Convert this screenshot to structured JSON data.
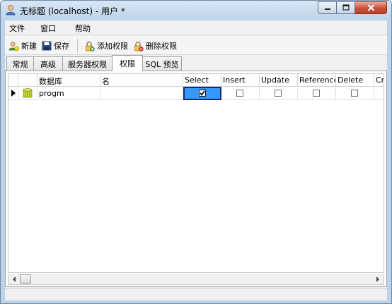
{
  "window": {
    "title": "无标题 (localhost) - 用户 *",
    "icon": "user-icon"
  },
  "menu": {
    "items": [
      "文件",
      "窗口",
      "帮助"
    ]
  },
  "toolbar": {
    "new_label": "新建",
    "save_label": "保存",
    "add_perm_label": "添加权限",
    "delete_perm_label": "删除权限"
  },
  "tabs": [
    {
      "label": "常规",
      "active": false
    },
    {
      "label": "高级",
      "active": false
    },
    {
      "label": "服务器权限",
      "active": false
    },
    {
      "label": "权限",
      "active": true
    },
    {
      "label": "SQL 预览",
      "active": false
    }
  ],
  "grid": {
    "columns": [
      "数据库",
      "名",
      "Select",
      "Insert",
      "Update",
      "Reference",
      "Delete",
      "Cr"
    ],
    "rows": [
      {
        "database": "progm",
        "name": "",
        "icon": "database-icon",
        "select": true,
        "insert": false,
        "update": false,
        "reference": false,
        "delete": false
      }
    ]
  },
  "colors": {
    "selected_cell": "#3399ff",
    "close_button": "#c7503a"
  }
}
